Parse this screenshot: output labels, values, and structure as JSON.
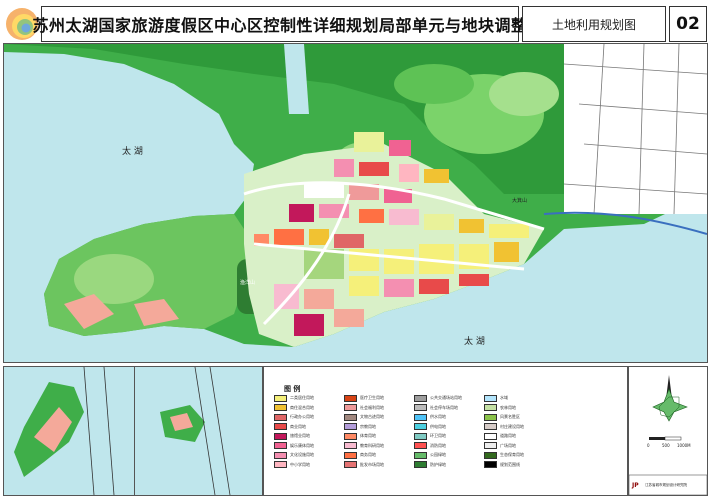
{
  "header": {
    "title": "苏州太湖国家旅游度假区中心区控制性详细规划局部单元与地块调整",
    "sheet_name": "土地利用规划图",
    "sheet_number": "02"
  },
  "map": {
    "lake_labels": [
      "太 湖",
      "太 湖"
    ],
    "hill_labels": [
      "渔洋山",
      "大箕山"
    ]
  },
  "legend": {
    "title": "图 例",
    "items": [
      {
        "label": "二类居住用地",
        "color": "#f5f07a"
      },
      {
        "label": "商住混合用地",
        "color": "#f1c232"
      },
      {
        "label": "行政办公用地",
        "color": "#e06666"
      },
      {
        "label": "商业用地",
        "color": "#e84a4a"
      },
      {
        "label": "旅馆业用地",
        "color": "#c2185b"
      },
      {
        "label": "娱乐康体用地",
        "color": "#f06292"
      },
      {
        "label": "文化设施用地",
        "color": "#f48fb1"
      },
      {
        "label": "中小学用地",
        "color": "#ffb6c1"
      },
      {
        "label": "医疗卫生用地",
        "color": "#d84315"
      },
      {
        "label": "社会福利用地",
        "color": "#ef9a9a"
      },
      {
        "label": "文物古迹用地",
        "color": "#a1887f"
      },
      {
        "label": "宗教用地",
        "color": "#b39ddb"
      },
      {
        "label": "体育用地",
        "color": "#ff8a65"
      },
      {
        "label": "教育科研用地",
        "color": "#f8bbd0"
      },
      {
        "label": "商务用地",
        "color": "#ff7043"
      },
      {
        "label": "批发市场用地",
        "color": "#e57373"
      },
      {
        "label": "公共交通场站用地",
        "color": "#9e9e9e"
      },
      {
        "label": "社会停车场用地",
        "color": "#bdbdbd"
      },
      {
        "label": "供水用地",
        "color": "#4fc3f7"
      },
      {
        "label": "供电用地",
        "color": "#4dd0e1"
      },
      {
        "label": "环卫用地",
        "color": "#80cbc4"
      },
      {
        "label": "消防用地",
        "color": "#ff5252"
      },
      {
        "label": "公园绿地",
        "color": "#66bb6a"
      },
      {
        "label": "防护绿地",
        "color": "#2e7d32"
      },
      {
        "label": "水域",
        "color": "#b3e5fc"
      },
      {
        "label": "农林用地",
        "color": "#c5e1a5"
      },
      {
        "label": "风景名胜区",
        "color": "#8bc34a"
      },
      {
        "label": "村庄建设用地",
        "color": "#d7ccc8"
      },
      {
        "label": "道路用地",
        "color": "#ffffff"
      },
      {
        "label": "广场用地",
        "color": "#eeeeee"
      },
      {
        "label": "生态保育用地",
        "color": "#33691e"
      },
      {
        "label": "规划范围线",
        "color": "#000000"
      }
    ]
  },
  "scale": {
    "ticks": [
      "0",
      "500",
      "1000M"
    ]
  },
  "credit": {
    "org": "江苏省城市规划设计研究院",
    "mark": "JP"
  }
}
